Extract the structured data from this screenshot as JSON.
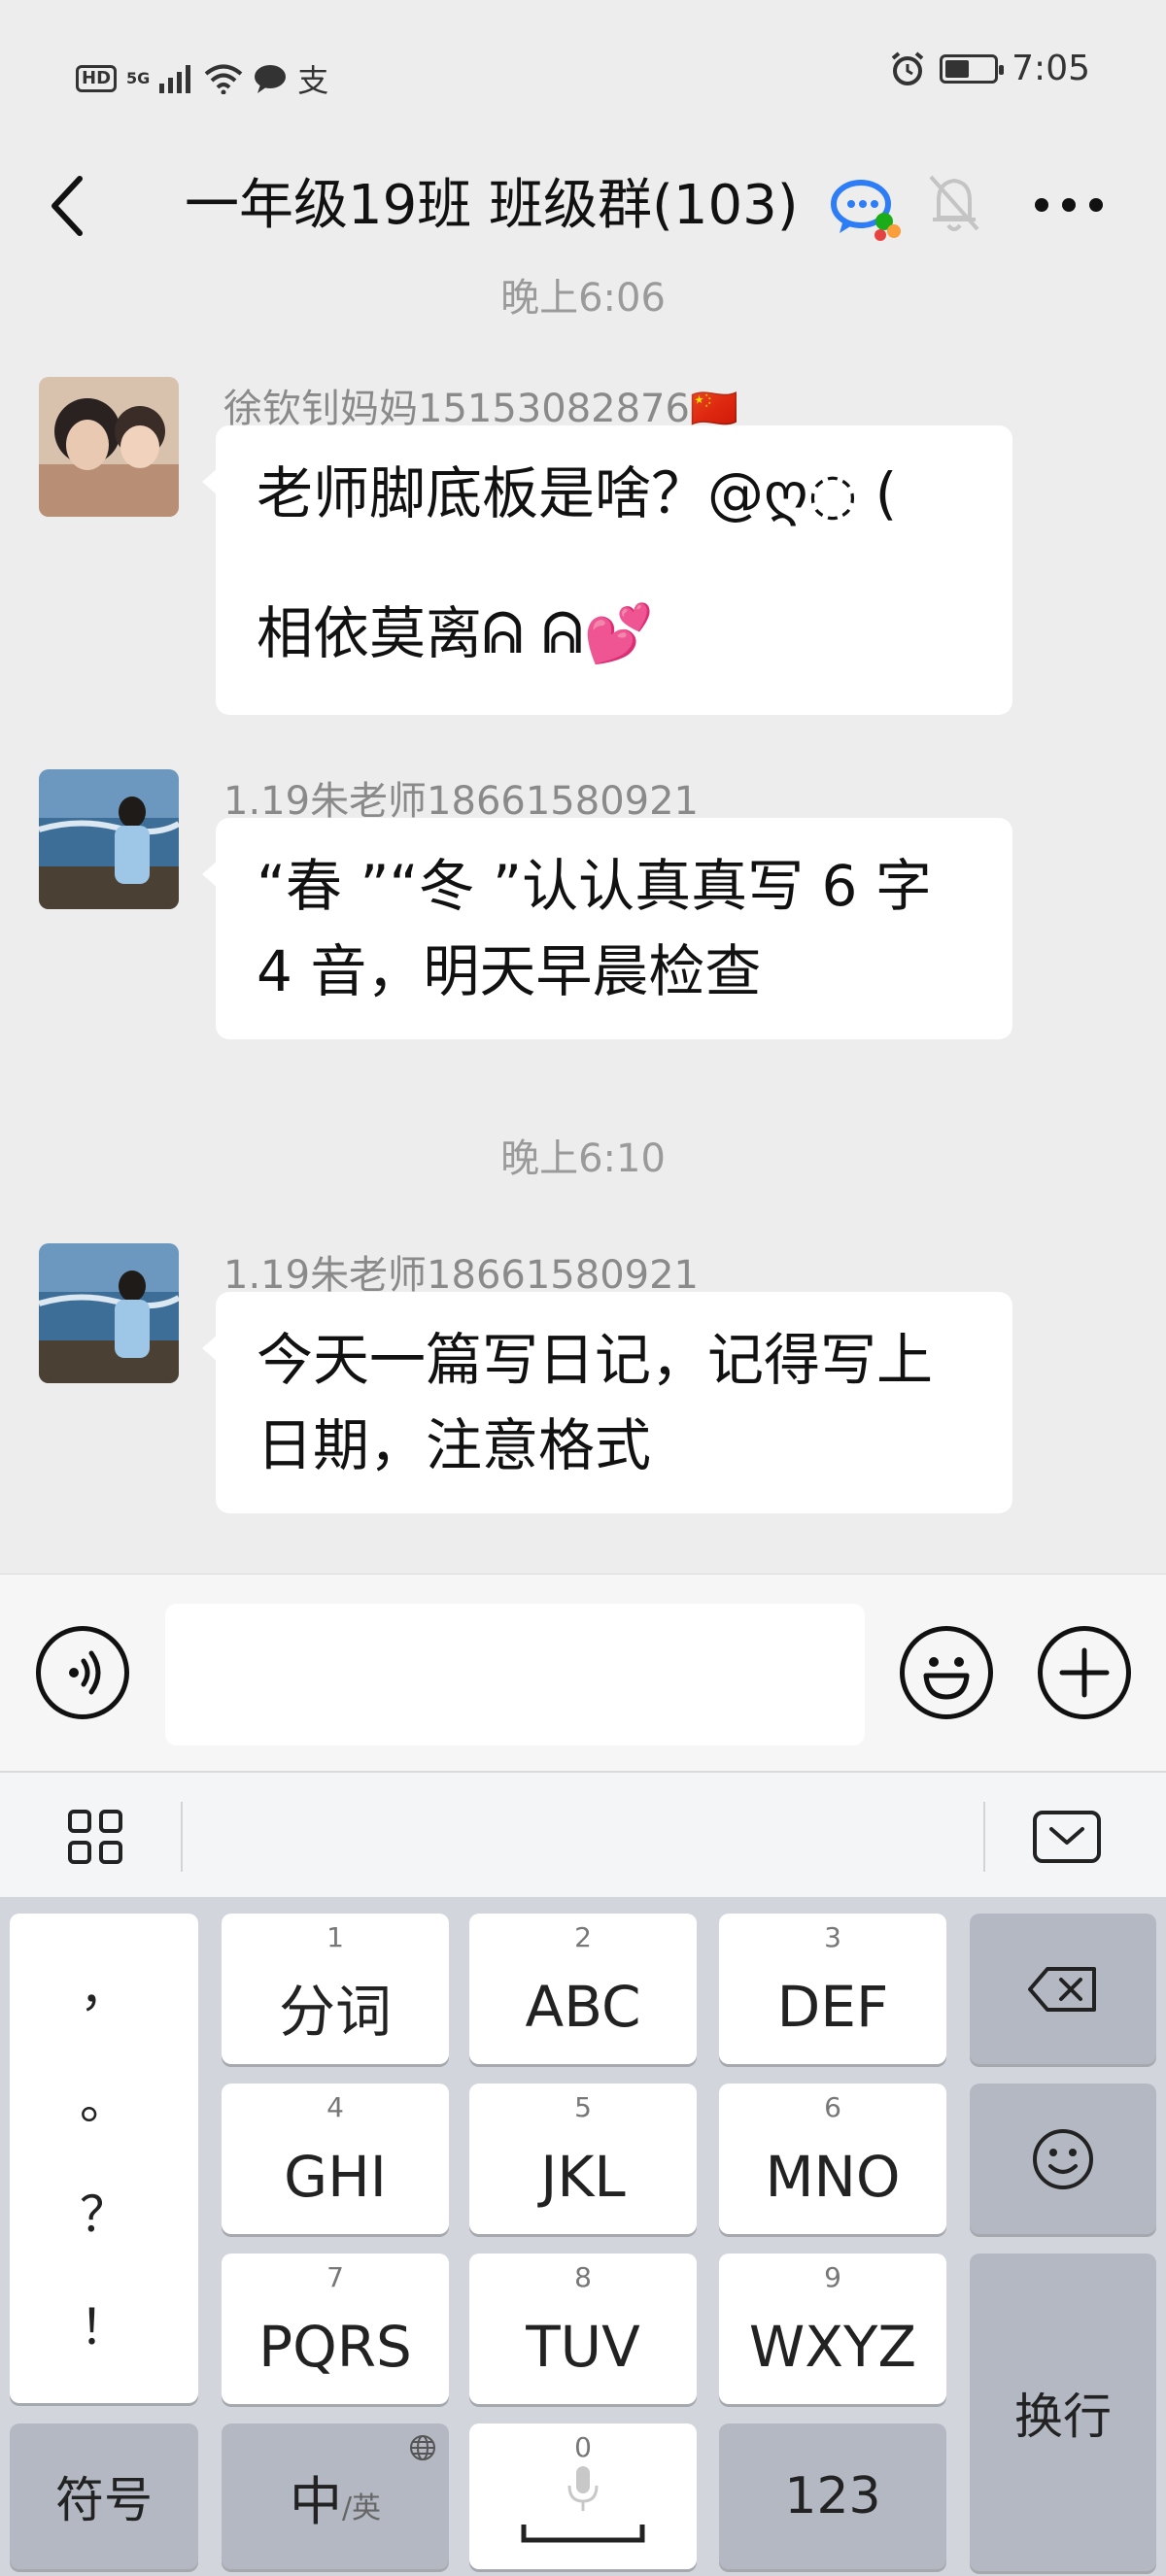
{
  "status_bar": {
    "hd": "HD",
    "network": "5G",
    "pay_glyph": "支",
    "time": "7:05",
    "battery_level": 0.5
  },
  "nav": {
    "title": "一年级19班 班级群(103)",
    "icons": [
      "back-chevron-icon",
      "group-chat-icon",
      "mute-bell-icon",
      "more-icon"
    ]
  },
  "chat": {
    "time_1": "晚上6:06",
    "time_2": "晚上6:10",
    "messages": [
      {
        "sender": "徐钦钊妈妈15153082876🇨🇳",
        "line1": "老师脚底板是啥？@ღ◌ (",
        "line2": "相依莫离ᕱ ᕱ💕"
      },
      {
        "sender": "1.19朱老师18661580921",
        "text": "“春 ”“冬 ”认认真真写 6 字 4 音，明天早晨检查"
      },
      {
        "sender": "1.19朱老师18661580921",
        "text": "今天一篇写日记，记得写上日期，注意格式"
      }
    ]
  },
  "input_bar": {
    "value": "",
    "icons": [
      "voice-icon",
      "emoji-icon",
      "plus-icon"
    ]
  },
  "keyboard": {
    "toolbar_icons": [
      "grid-menu-icon",
      "collapse-keyboard-icon"
    ],
    "punct": [
      "，",
      "。",
      "？",
      "！"
    ],
    "keys": [
      {
        "num": "1",
        "label": "分词"
      },
      {
        "num": "2",
        "label": "ABC"
      },
      {
        "num": "3",
        "label": "DEF"
      },
      {
        "num": "4",
        "label": "GHI"
      },
      {
        "num": "5",
        "label": "JKL"
      },
      {
        "num": "6",
        "label": "MNO"
      },
      {
        "num": "7",
        "label": "PQRS"
      },
      {
        "num": "8",
        "label": "TUV"
      },
      {
        "num": "9",
        "label": "WXYZ"
      }
    ],
    "bottom": {
      "symbols": "符号",
      "lang_main": "中",
      "lang_alt": "/英",
      "space_num": "0",
      "numbers": "123"
    },
    "enter": "换行"
  }
}
